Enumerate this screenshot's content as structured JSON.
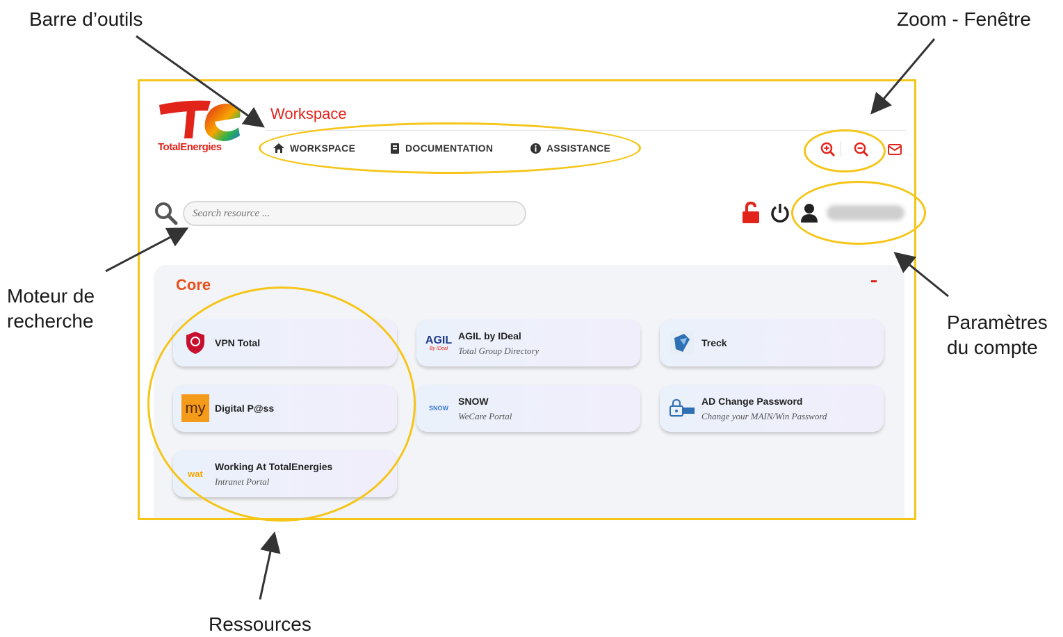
{
  "callouts": {
    "toolbar": "Barre d’outils",
    "zoom": "Zoom - Fenêtre",
    "search_line1": "Moteur de",
    "search_line2": "recherche",
    "account_line1": "Paramètres",
    "account_line2": "du compte",
    "resources": "Ressources"
  },
  "header": {
    "brand": "TotalEnergies",
    "title": "Workspace"
  },
  "nav": {
    "workspace": "WORKSPACE",
    "documentation": "DOCUMENTATION",
    "assistance": "ASSISTANCE"
  },
  "search": {
    "placeholder": "Search resource ..."
  },
  "section": {
    "title": "Core",
    "collapse": "-"
  },
  "cards": {
    "vpn": {
      "name": "VPN Total"
    },
    "agil": {
      "name": "AGIL by IDeal",
      "sub": "Total Group Directory",
      "logo": "AGIL",
      "logo_sub": "By IDeal"
    },
    "treck": {
      "name": "Treck"
    },
    "digital": {
      "name": "Digital P@ss",
      "logo": "my"
    },
    "snow": {
      "name": "SNOW",
      "sub": "WeCare Portal",
      "logo": "SNOW"
    },
    "ad": {
      "name": "AD Change Password",
      "sub": "Change your MAIN/Win Password"
    },
    "wat": {
      "name": "Working At TotalEnergies",
      "sub": "Intranet Portal",
      "logo": "wat"
    }
  },
  "colors": {
    "accent_red": "#e2231a",
    "highlight_yellow": "#f5c518",
    "section_title": "#e8501a"
  },
  "icons": [
    "home-icon",
    "book-icon",
    "info-icon",
    "zoom-in-icon",
    "zoom-out-icon",
    "mail-icon",
    "search-icon",
    "unlock-icon",
    "power-icon",
    "user-icon",
    "shield-icon",
    "key-icon"
  ]
}
